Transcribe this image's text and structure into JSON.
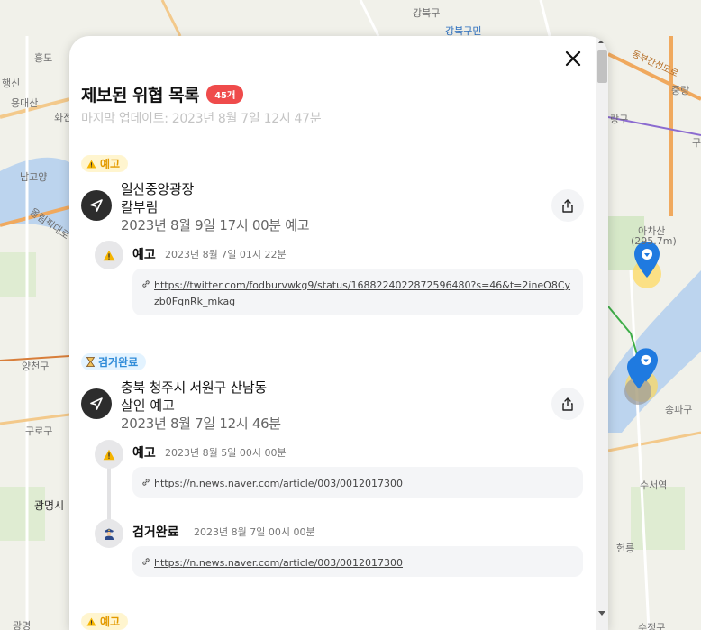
{
  "panel": {
    "title": "제보된 위협 목록",
    "count_badge": "45개",
    "last_update": "마지막 업데이트: 2023년 8월 7일 12시 47분"
  },
  "entries": [
    {
      "status_tag": "예고",
      "place": "일산중앙광장",
      "threat_type": "칼부림",
      "date": "2023년 8월 9일 17시 00분 예고",
      "events": [
        {
          "title": "예고",
          "date": "2023년 8월 7일 01시 22분",
          "link": "https://twitter.com/fodburvwkg9/status/1688224022872596480?s=46&t=2ineO8Cyzb0FqnRk_mkag"
        }
      ]
    },
    {
      "status_tag": "검거완료",
      "place": "충북 청주시 서원구 산남동",
      "threat_type": "살인 예고",
      "date": "2023년 8월 7일 12시 46분",
      "events": [
        {
          "title": "예고",
          "date": "2023년 8월 5일 00시 00분",
          "link": "https://n.news.naver.com/article/003/0012017300"
        },
        {
          "title": "검거완료",
          "date": "2023년 8월 7일 00시 00분",
          "link": "https://n.news.naver.com/article/003/0012017300"
        }
      ]
    },
    {
      "status_tag": "예고"
    }
  ],
  "map_labels": {
    "l1": "강북구",
    "l2": "강북구민",
    "l3": "흥도",
    "l4": "행신",
    "l5": "용대산",
    "l6": "화전",
    "l7": "남고양",
    "l8": "올림픽대로",
    "l9": "양천구",
    "l10": "구로구",
    "l11": "광명시",
    "l12": "광명",
    "l13": "중랑",
    "l14": "아차산",
    "l15": "(295.7m)",
    "l16": "송파구",
    "l17": "수서역",
    "l18": "헌릉",
    "l19": "수정구",
    "l20": "구",
    "l21": "동부간선도로",
    "l22": "랑구"
  },
  "colors": {
    "accent_red": "#ef4b4b",
    "warn_tag_bg": "#fff5cf",
    "warn_tag_text": "#e39a00",
    "done_tag_bg": "#e3f3ff",
    "done_tag_text": "#2f8bd8",
    "marker_blue": "#1f7ae0"
  }
}
